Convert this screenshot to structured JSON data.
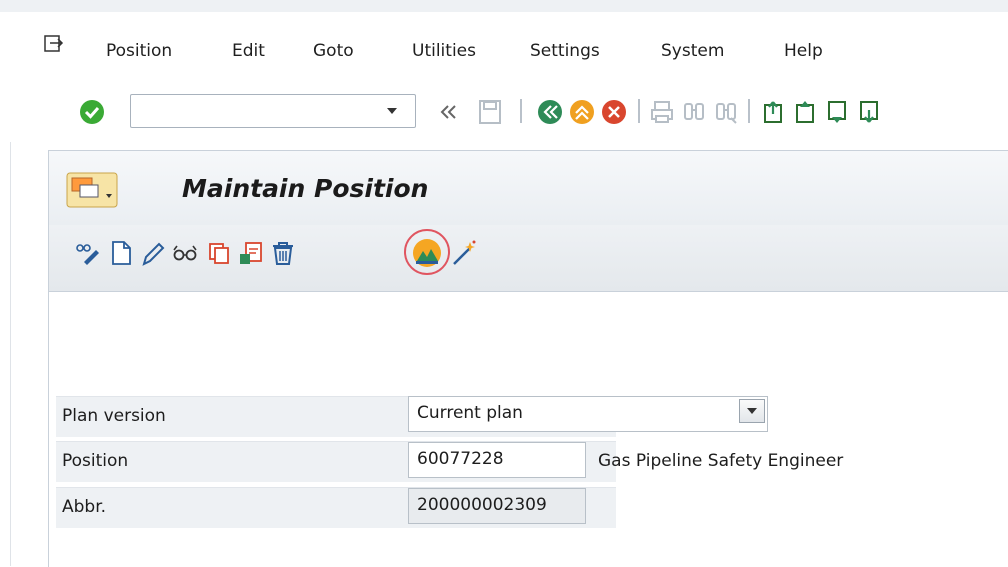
{
  "menubar": {
    "items": [
      "Position",
      "Edit",
      "Goto",
      "Utilities",
      "Settings",
      "System",
      "Help"
    ]
  },
  "toolbar": {
    "command_field": {
      "value": "",
      "placeholder": ""
    },
    "icons": [
      "enter-icon",
      "command-dropdown-icon",
      "collapse-icon",
      "save-icon",
      "back-icon",
      "exit-icon",
      "cancel-icon",
      "print-icon",
      "find-icon",
      "find-next-icon",
      "first-page-icon",
      "previous-page-icon",
      "next-page-icon",
      "last-page-icon"
    ]
  },
  "screen": {
    "title": "Maintain Position",
    "app_toolbar_icons": [
      "enrich-icon",
      "create-icon",
      "change-icon",
      "display-icon",
      "copy-icon",
      "delimit-icon",
      "delete-icon",
      "overview-icon",
      "wizard-icon"
    ]
  },
  "form": {
    "plan_version": {
      "label": "Plan version",
      "value": "Current plan"
    },
    "position": {
      "label": "Position",
      "value": "60077228",
      "description": "Gas Pipeline Safety Engineer"
    },
    "abbr": {
      "label": "Abbr.",
      "value": "200000002309"
    }
  },
  "colors": {
    "accent_green": "#3aaa35",
    "back_green": "#2e8b57",
    "exit_orange": "#f0a020",
    "cancel_red": "#d9462e",
    "highlight_ring": "#e05560"
  }
}
